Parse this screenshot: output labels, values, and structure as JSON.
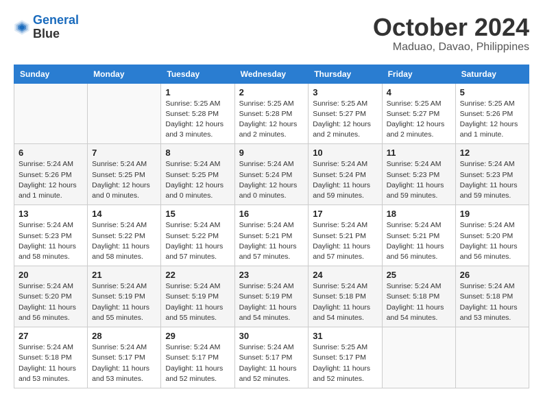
{
  "logo": {
    "line1": "General",
    "line2": "Blue"
  },
  "title": "October 2024",
  "location": "Maduao, Davao, Philippines",
  "weekdays": [
    "Sunday",
    "Monday",
    "Tuesday",
    "Wednesday",
    "Thursday",
    "Friday",
    "Saturday"
  ],
  "weeks": [
    [
      null,
      null,
      {
        "day": "1",
        "sunrise": "5:25 AM",
        "sunset": "5:28 PM",
        "daylight": "12 hours and 3 minutes."
      },
      {
        "day": "2",
        "sunrise": "5:25 AM",
        "sunset": "5:28 PM",
        "daylight": "12 hours and 2 minutes."
      },
      {
        "day": "3",
        "sunrise": "5:25 AM",
        "sunset": "5:27 PM",
        "daylight": "12 hours and 2 minutes."
      },
      {
        "day": "4",
        "sunrise": "5:25 AM",
        "sunset": "5:27 PM",
        "daylight": "12 hours and 2 minutes."
      },
      {
        "day": "5",
        "sunrise": "5:25 AM",
        "sunset": "5:26 PM",
        "daylight": "12 hours and 1 minute."
      }
    ],
    [
      {
        "day": "6",
        "sunrise": "5:24 AM",
        "sunset": "5:26 PM",
        "daylight": "12 hours and 1 minute."
      },
      {
        "day": "7",
        "sunrise": "5:24 AM",
        "sunset": "5:25 PM",
        "daylight": "12 hours and 0 minutes."
      },
      {
        "day": "8",
        "sunrise": "5:24 AM",
        "sunset": "5:25 PM",
        "daylight": "12 hours and 0 minutes."
      },
      {
        "day": "9",
        "sunrise": "5:24 AM",
        "sunset": "5:24 PM",
        "daylight": "12 hours and 0 minutes."
      },
      {
        "day": "10",
        "sunrise": "5:24 AM",
        "sunset": "5:24 PM",
        "daylight": "11 hours and 59 minutes."
      },
      {
        "day": "11",
        "sunrise": "5:24 AM",
        "sunset": "5:23 PM",
        "daylight": "11 hours and 59 minutes."
      },
      {
        "day": "12",
        "sunrise": "5:24 AM",
        "sunset": "5:23 PM",
        "daylight": "11 hours and 59 minutes."
      }
    ],
    [
      {
        "day": "13",
        "sunrise": "5:24 AM",
        "sunset": "5:23 PM",
        "daylight": "11 hours and 58 minutes."
      },
      {
        "day": "14",
        "sunrise": "5:24 AM",
        "sunset": "5:22 PM",
        "daylight": "11 hours and 58 minutes."
      },
      {
        "day": "15",
        "sunrise": "5:24 AM",
        "sunset": "5:22 PM",
        "daylight": "11 hours and 57 minutes."
      },
      {
        "day": "16",
        "sunrise": "5:24 AM",
        "sunset": "5:21 PM",
        "daylight": "11 hours and 57 minutes."
      },
      {
        "day": "17",
        "sunrise": "5:24 AM",
        "sunset": "5:21 PM",
        "daylight": "11 hours and 57 minutes."
      },
      {
        "day": "18",
        "sunrise": "5:24 AM",
        "sunset": "5:21 PM",
        "daylight": "11 hours and 56 minutes."
      },
      {
        "day": "19",
        "sunrise": "5:24 AM",
        "sunset": "5:20 PM",
        "daylight": "11 hours and 56 minutes."
      }
    ],
    [
      {
        "day": "20",
        "sunrise": "5:24 AM",
        "sunset": "5:20 PM",
        "daylight": "11 hours and 56 minutes."
      },
      {
        "day": "21",
        "sunrise": "5:24 AM",
        "sunset": "5:19 PM",
        "daylight": "11 hours and 55 minutes."
      },
      {
        "day": "22",
        "sunrise": "5:24 AM",
        "sunset": "5:19 PM",
        "daylight": "11 hours and 55 minutes."
      },
      {
        "day": "23",
        "sunrise": "5:24 AM",
        "sunset": "5:19 PM",
        "daylight": "11 hours and 54 minutes."
      },
      {
        "day": "24",
        "sunrise": "5:24 AM",
        "sunset": "5:18 PM",
        "daylight": "11 hours and 54 minutes."
      },
      {
        "day": "25",
        "sunrise": "5:24 AM",
        "sunset": "5:18 PM",
        "daylight": "11 hours and 54 minutes."
      },
      {
        "day": "26",
        "sunrise": "5:24 AM",
        "sunset": "5:18 PM",
        "daylight": "11 hours and 53 minutes."
      }
    ],
    [
      {
        "day": "27",
        "sunrise": "5:24 AM",
        "sunset": "5:18 PM",
        "daylight": "11 hours and 53 minutes."
      },
      {
        "day": "28",
        "sunrise": "5:24 AM",
        "sunset": "5:17 PM",
        "daylight": "11 hours and 53 minutes."
      },
      {
        "day": "29",
        "sunrise": "5:24 AM",
        "sunset": "5:17 PM",
        "daylight": "11 hours and 52 minutes."
      },
      {
        "day": "30",
        "sunrise": "5:24 AM",
        "sunset": "5:17 PM",
        "daylight": "11 hours and 52 minutes."
      },
      {
        "day": "31",
        "sunrise": "5:25 AM",
        "sunset": "5:17 PM",
        "daylight": "11 hours and 52 minutes."
      },
      null,
      null
    ]
  ],
  "labels": {
    "sunrise": "Sunrise:",
    "sunset": "Sunset:",
    "daylight": "Daylight:"
  }
}
